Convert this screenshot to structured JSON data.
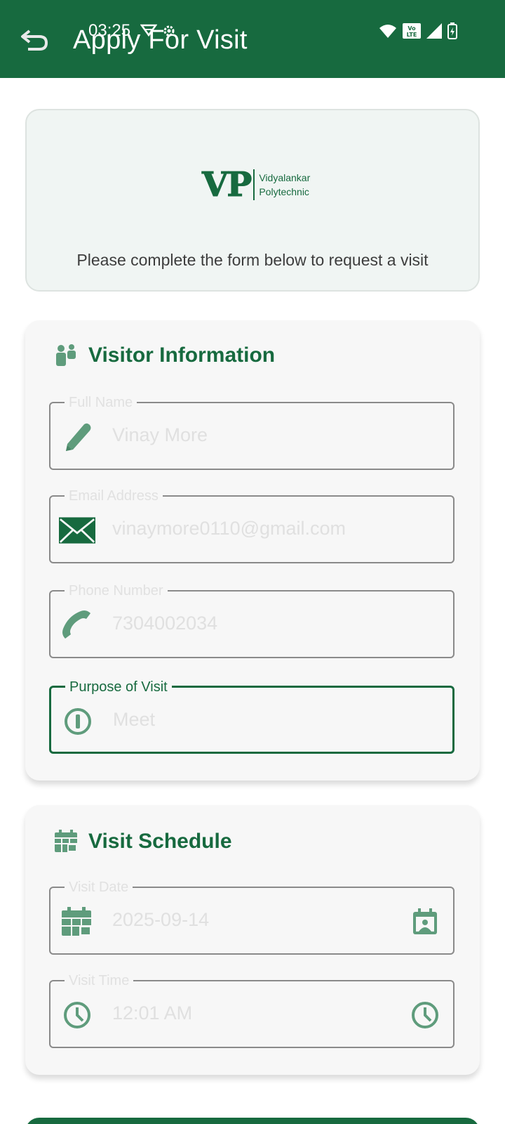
{
  "status": {
    "time": "03:25"
  },
  "header": {
    "title": "Apply For Visit"
  },
  "intro": {
    "logo_mark": "VP",
    "logo_line1": "Vidyalankar",
    "logo_line2": "Polytechnic",
    "subtitle": "Please complete the form below to request a visit"
  },
  "visitor_info": {
    "title": "Visitor Information",
    "fields": [
      {
        "label": "Full Name",
        "value": "Vinay More",
        "icon": "pencil-icon"
      },
      {
        "label": "Email Address",
        "value": "vinaymore0110@gmail.com",
        "icon": "envelope-icon"
      },
      {
        "label": "Phone Number",
        "value": "7304002034",
        "icon": "phone-icon"
      },
      {
        "label": "Purpose of Visit",
        "value": "Meet",
        "icon": "info-icon"
      }
    ]
  },
  "visit_schedule": {
    "title": "Visit Schedule",
    "fields": [
      {
        "label": "Visit Date",
        "value": "2025-09-14",
        "icon": "calendar-icon",
        "trailing_icon": "calendar-pick-icon"
      },
      {
        "label": "Visit Time",
        "value": "12:01 AM",
        "icon": "clock-icon",
        "trailing_icon": "clock-icon"
      }
    ]
  },
  "colors": {
    "primary": "#176a3f",
    "icon_muted": "#5f9c7c",
    "card_bg": "#f7f7f7"
  }
}
